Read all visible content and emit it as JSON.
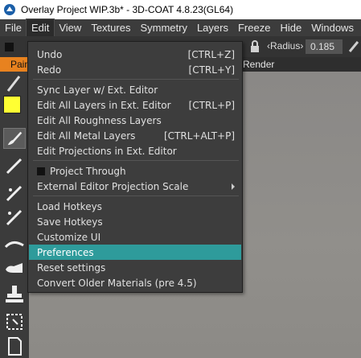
{
  "window": {
    "title": "Overlay Project WIP.3b* - 3D-COAT 4.8.23(GL64)"
  },
  "menubar": {
    "items": [
      "File",
      "Edit",
      "View",
      "Textures",
      "Symmetry",
      "Layers",
      "Freeze",
      "Hide",
      "Windows"
    ]
  },
  "toolbar": {
    "radius_label": "Radius",
    "radius_value": "0.185"
  },
  "tabs": {
    "paint": "Paint",
    "render": "Render"
  },
  "colors": {
    "accent_highlight": "#2e9b9b",
    "paint_tab": "#e8821f",
    "swatch": "#ffff33"
  },
  "edit_menu": {
    "undo": {
      "label": "Undo",
      "shortcut": "[CTRL+Z]"
    },
    "redo": {
      "label": "Redo",
      "shortcut": "[CTRL+Y]"
    },
    "sync_layer": {
      "label": "Sync Layer w/ Ext. Editor"
    },
    "edit_all_layers": {
      "label": "Edit All Layers in Ext. Editor",
      "shortcut": "[CTRL+P]"
    },
    "edit_roughness": {
      "label": "Edit All Roughness Layers"
    },
    "edit_metal": {
      "label": "Edit All Metal Layers",
      "shortcut": "[CTRL+ALT+P]"
    },
    "edit_projections": {
      "label": "Edit Projections in Ext. Editor"
    },
    "project_through": {
      "label": "Project Through"
    },
    "ext_projection_scale": {
      "label": "External Editor Projection Scale"
    },
    "load_hotkeys": {
      "label": "Load Hotkeys"
    },
    "save_hotkeys": {
      "label": "Save Hotkeys"
    },
    "customize_ui": {
      "label": "Customize UI"
    },
    "preferences": {
      "label": "Preferences"
    },
    "reset_settings": {
      "label": "Reset settings"
    },
    "convert_materials": {
      "label": "Convert Older Materials (pre 4.5)"
    }
  }
}
